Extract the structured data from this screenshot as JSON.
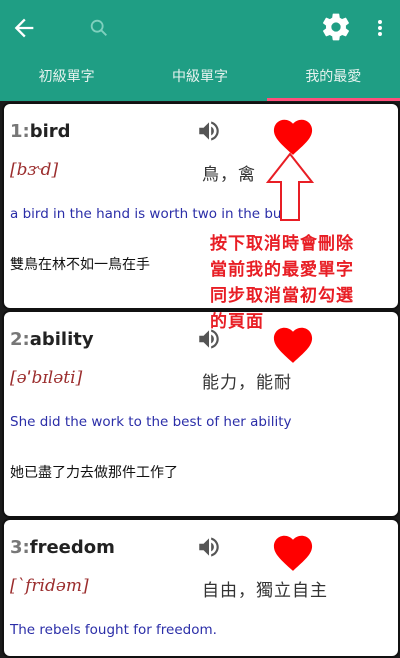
{
  "appbar": {
    "back_icon": "arrow-left-icon",
    "search_icon": "search-icon",
    "settings_icon": "gear-icon",
    "more_icon": "more-vert-icon"
  },
  "tabs": [
    {
      "label": "初級單字",
      "active": false
    },
    {
      "label": "中級單字",
      "active": false
    },
    {
      "label": "我的最愛",
      "active": true
    }
  ],
  "colors": {
    "primary": "#1f9e84",
    "tab_indicator": "#ff4f7b",
    "heart": "#ff0000",
    "annotation": "#e81e25"
  },
  "cards": [
    {
      "index": "1:",
      "word": "bird",
      "phonetic": "[bɝd]",
      "meaning": "鳥，禽",
      "sentence": "a bird in the hand is worth two in the bush",
      "translation": "雙鳥在林不如一鳥在手"
    },
    {
      "index": "2:",
      "word": "ability",
      "phonetic": "[əˈbɪləti]",
      "meaning": "能力，能耐",
      "sentence": "She did the work to the best of her ability",
      "translation": "她已盡了力去做那件工作了"
    },
    {
      "index": "3:",
      "word": "freedom",
      "phonetic": "[ˋfridəm]",
      "meaning": "自由，獨立自主",
      "sentence": "The rebels fought for freedom.",
      "translation": ""
    }
  ],
  "annotation": {
    "lines": [
      "按下取消時會刪除",
      "當前我的最愛單字",
      "同步取消當初勾選",
      "的頁面"
    ]
  }
}
